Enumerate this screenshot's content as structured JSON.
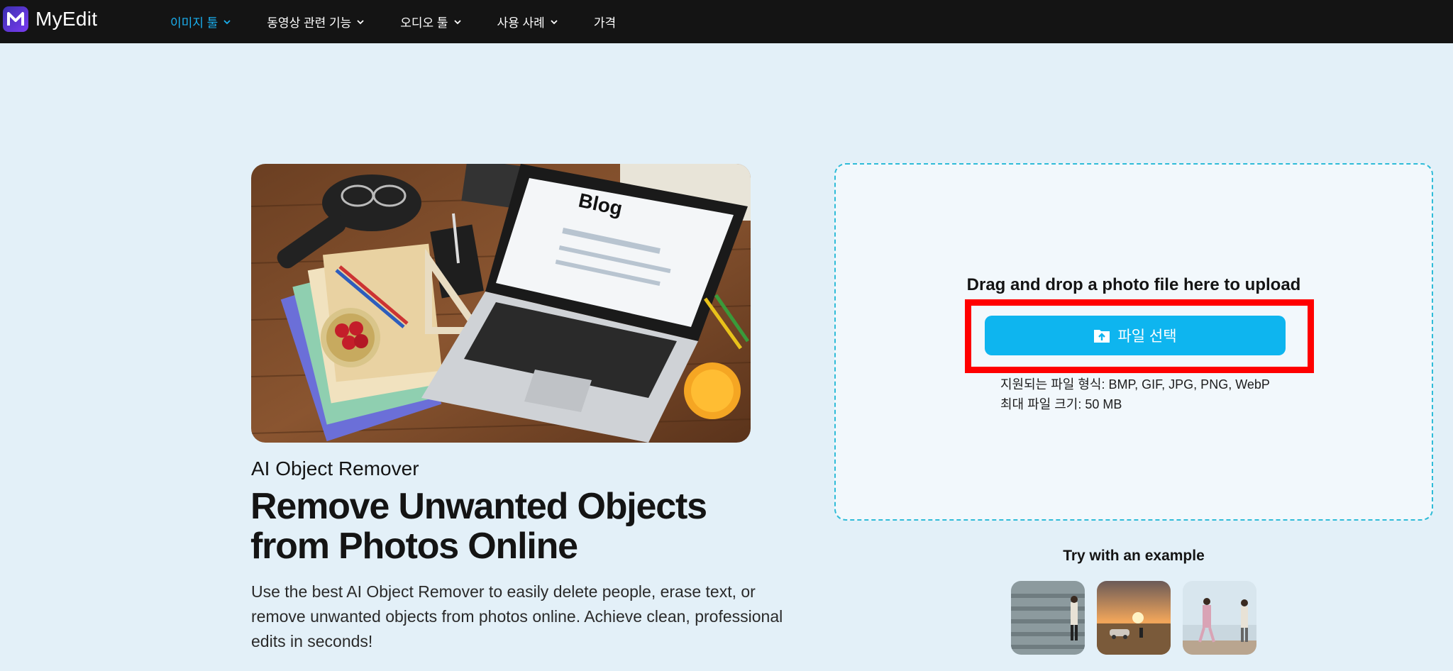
{
  "brand": {
    "name": "MyEdit"
  },
  "nav": {
    "items": [
      {
        "label": "이미지 툴",
        "active": true
      },
      {
        "label": "동영상 관련 기능",
        "active": false
      },
      {
        "label": "오디오 툴",
        "active": false
      },
      {
        "label": "사용 사례",
        "active": false
      },
      {
        "label": "가격",
        "active": false
      }
    ]
  },
  "hero": {
    "image_text": "Blog",
    "subtitle": "AI Object Remover",
    "title": "Remove Unwanted Objects from Photos Online",
    "description": "Use the best AI Object Remover to easily delete people, erase text, or remove unwanted objects from photos online. Achieve clean, professional edits in seconds!"
  },
  "upload": {
    "drop_text": "Drag and drop a photo file here to upload",
    "button_label": "파일 선택",
    "supported_formats": "지원되는 파일 형식: BMP, GIF, JPG, PNG, WebP",
    "max_size": "최대 파일 크기: 50 MB"
  },
  "examples": {
    "title": "Try with an example",
    "thumbnails": [
      "example-stairs",
      "example-beach-car",
      "example-seaside-walk"
    ]
  },
  "colors": {
    "accent": "#0eb5ef",
    "nav_active": "#1ab0f0",
    "highlight": "#ff0000",
    "background": "#e3f0f8"
  }
}
